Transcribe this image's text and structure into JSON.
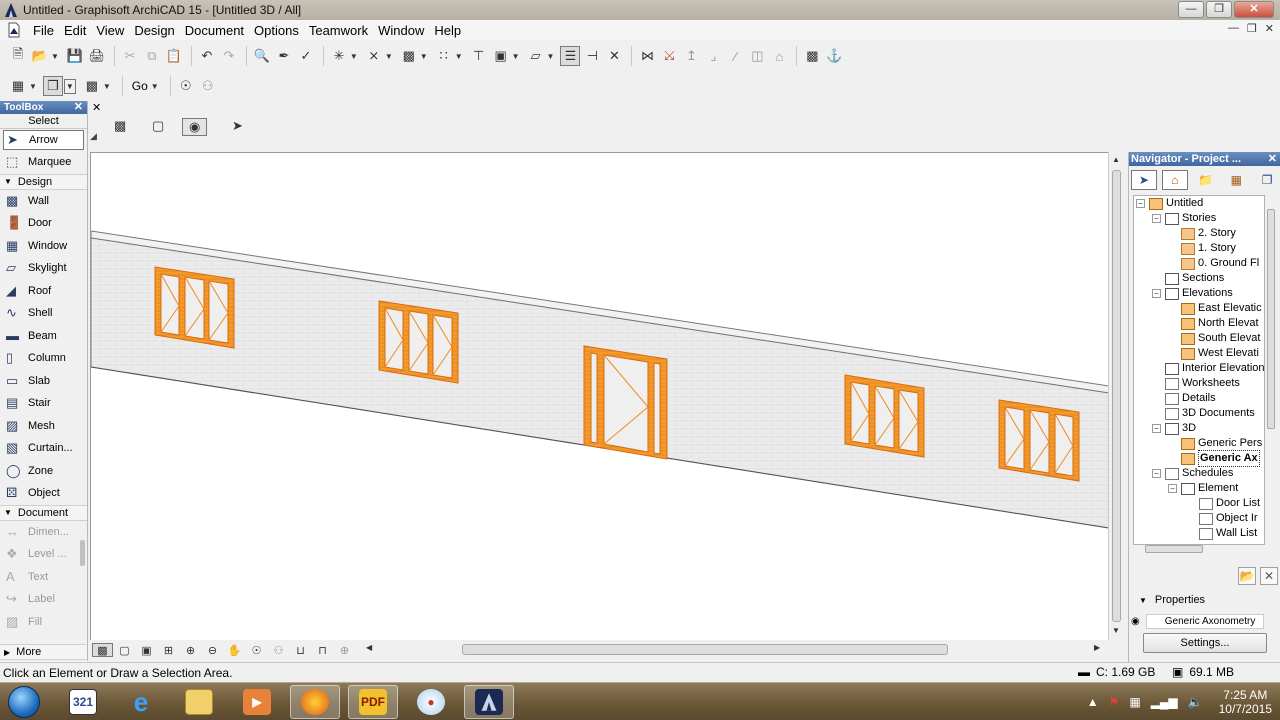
{
  "window": {
    "title": "Untitled - Graphisoft ArchiCAD 15 - [Untitled 3D / All]",
    "minimize_icon": "minimize-icon",
    "restore_icon": "restore-icon",
    "close_icon": "close-icon"
  },
  "menubar": {
    "items": [
      "File",
      "Edit",
      "View",
      "Design",
      "Document",
      "Options",
      "Teamwork",
      "Window",
      "Help"
    ]
  },
  "toolbar2": {
    "go_label": "Go"
  },
  "toolbox": {
    "title": "ToolBox",
    "select_label": "Select",
    "select_tools": [
      "Arrow",
      "Marquee"
    ],
    "design_label": "Design",
    "design_tools": [
      "Wall",
      "Door",
      "Window",
      "Skylight",
      "Roof",
      "Shell",
      "Beam",
      "Column",
      "Slab",
      "Stair",
      "Mesh",
      "Curtain...",
      "Zone",
      "Object"
    ],
    "document_label": "Document",
    "document_tools": [
      "Dimen...",
      "Level ...",
      "Text",
      "Label",
      "Fill"
    ],
    "more_label": "More"
  },
  "navigator": {
    "title": "Navigator - Project ...",
    "tree": [
      {
        "label": "Untitled",
        "level": 0
      },
      {
        "label": "Stories",
        "level": 1
      },
      {
        "label": "2. Story",
        "level": 2
      },
      {
        "label": "1. Story",
        "level": 2
      },
      {
        "label": "0. Ground Fl",
        "level": 2
      },
      {
        "label": "Sections",
        "level": 1
      },
      {
        "label": "Elevations",
        "level": 1
      },
      {
        "label": "East Elevatic",
        "level": 2
      },
      {
        "label": "North Elevat",
        "level": 2
      },
      {
        "label": "South Elevat",
        "level": 2
      },
      {
        "label": "West Elevati",
        "level": 2
      },
      {
        "label": "Interior Elevation",
        "level": 1
      },
      {
        "label": "Worksheets",
        "level": 1
      },
      {
        "label": "Details",
        "level": 1
      },
      {
        "label": "3D Documents",
        "level": 1
      },
      {
        "label": "3D",
        "level": 1
      },
      {
        "label": "Generic Pers",
        "level": 2
      },
      {
        "label": "Generic Ax",
        "level": 2
      },
      {
        "label": "Schedules",
        "level": 1
      },
      {
        "label": "Element",
        "level": 2
      },
      {
        "label": "Door List",
        "level": 3
      },
      {
        "label": "Object Ir",
        "level": 3
      },
      {
        "label": "Wall List",
        "level": 3
      }
    ],
    "properties_label": "Properties",
    "properties_value": "Generic Axonometry",
    "settings_label": "Settings..."
  },
  "statusbar": {
    "message": "Click an Element or Draw a Selection Area.",
    "disk": "C: 1.69 GB",
    "memory": "69.1 MB"
  },
  "taskbar": {
    "apps": [
      "calendar-app",
      "internet-explorer",
      "file-explorer",
      "media-player",
      "firefox",
      "pdf-app",
      "paint-app",
      "archicad"
    ],
    "calendar_text": "321",
    "pdf_text": "PDF",
    "time": "7:25 AM",
    "date": "10/7/2015"
  },
  "colors": {
    "accent_orange": "#f08a1e",
    "wall_face": "#ececec",
    "title_blue": "#3f66a0"
  }
}
